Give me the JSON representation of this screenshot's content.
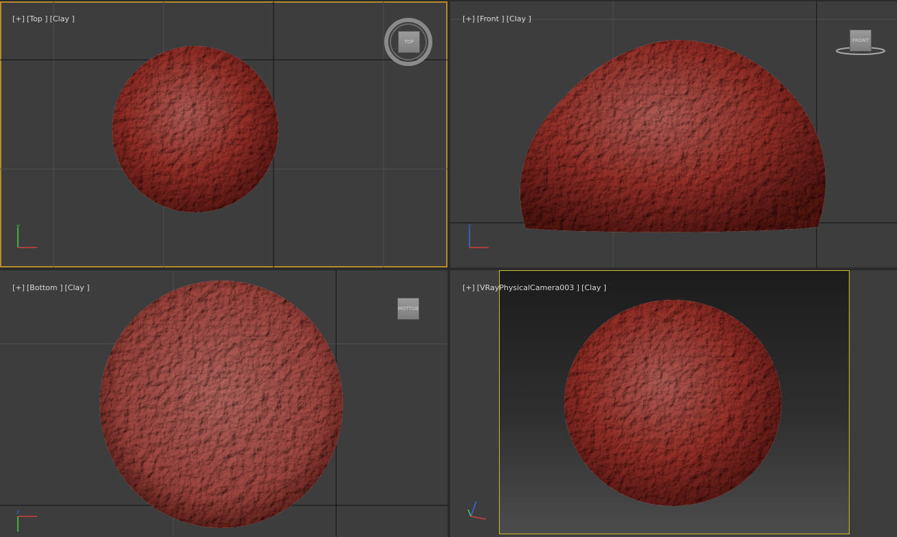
{
  "viewports": [
    {
      "id": "top",
      "plus": "[+]",
      "view": "[Top ]",
      "shading": "[Clay ]",
      "cube": "TOP"
    },
    {
      "id": "front",
      "plus": "[+]",
      "view": "[Front ]",
      "shading": "[Clay ]",
      "cube": "FRONT"
    },
    {
      "id": "bottom",
      "plus": "[+]",
      "view": "[Bottom ]",
      "shading": "[Clay ]",
      "cube": "BOTTOM"
    },
    {
      "id": "camera",
      "plus": "[+]",
      "view": "[VRayPhysicalCamera003 ]",
      "shading": "[Clay ]"
    }
  ],
  "axis_labels": {
    "x": "x",
    "y": "y",
    "z": "z"
  },
  "colors": {
    "clay": "#a84a42",
    "clay_dark": "#5e2420",
    "clay_light": "#c98580",
    "viewport_bg": "#3d3d3d",
    "active_border": "#b88a2e",
    "safe_frame": "#d0c020"
  }
}
